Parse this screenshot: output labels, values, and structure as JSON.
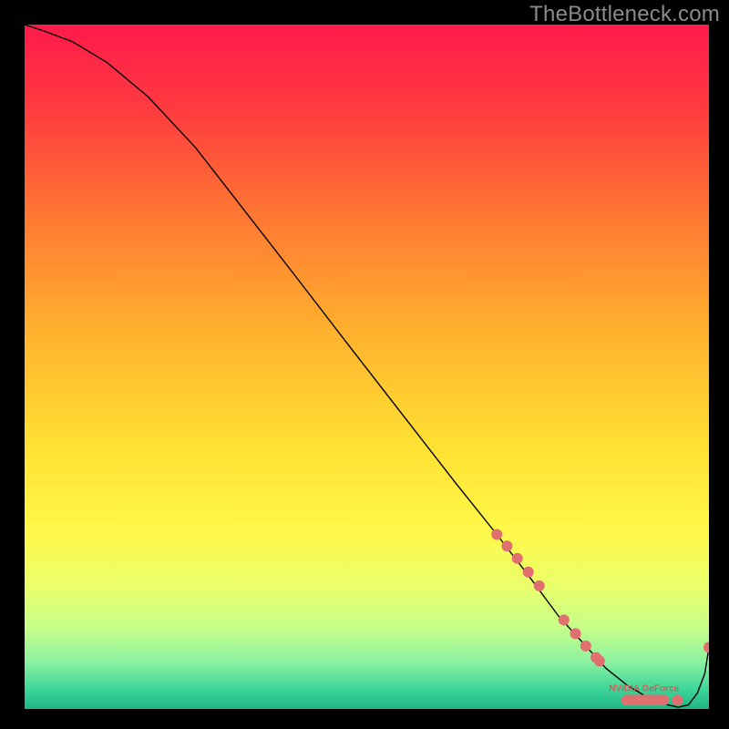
{
  "watermark": "TheBottleneck.com",
  "chart_data": {
    "type": "line",
    "title": "",
    "xlabel": "",
    "ylabel": "",
    "x_range": [
      0,
      100
    ],
    "y_range": [
      0,
      100
    ],
    "background": {
      "type": "vertical-gradient",
      "stops": [
        {
          "offset": 0.0,
          "color": "#ff1a4b"
        },
        {
          "offset": 0.12,
          "color": "#ff3a3f"
        },
        {
          "offset": 0.28,
          "color": "#ff7833"
        },
        {
          "offset": 0.45,
          "color": "#ffb22e"
        },
        {
          "offset": 0.62,
          "color": "#ffe233"
        },
        {
          "offset": 0.74,
          "color": "#fff84a"
        },
        {
          "offset": 0.82,
          "color": "#eaff6a"
        },
        {
          "offset": 0.88,
          "color": "#c7ff89"
        },
        {
          "offset": 0.93,
          "color": "#8ef2a0"
        },
        {
          "offset": 0.97,
          "color": "#3fd79a"
        },
        {
          "offset": 1.0,
          "color": "#1fb583"
        }
      ]
    },
    "series": [
      {
        "name": "curve",
        "color": "#000000",
        "width": 1.4,
        "x": [
          0,
          3,
          7,
          12,
          18,
          25,
          32,
          40,
          48,
          56,
          63,
          69,
          74,
          78,
          82,
          85,
          88,
          91,
          93.5,
          95.5,
          97,
          98.3,
          99.4,
          100
        ],
        "y": [
          100,
          99,
          97.5,
          94.5,
          89.5,
          82,
          73,
          62.7,
          52.3,
          42,
          33,
          25.5,
          19,
          13.6,
          9.2,
          5.9,
          3.5,
          1.7,
          0.7,
          0.25,
          0.6,
          2.3,
          5.2,
          9
        ]
      }
    ],
    "markers": {
      "color": "#e07070",
      "radius": 6,
      "points": [
        {
          "x": 69.0,
          "y": 25.5
        },
        {
          "x": 70.5,
          "y": 23.8
        },
        {
          "x": 72.0,
          "y": 22.0
        },
        {
          "x": 73.6,
          "y": 20.0
        },
        {
          "x": 75.2,
          "y": 18.0
        },
        {
          "x": 78.8,
          "y": 13.0
        },
        {
          "x": 80.5,
          "y": 11.0
        },
        {
          "x": 82.0,
          "y": 9.2
        },
        {
          "x": 83.5,
          "y": 7.5
        },
        {
          "x": 84.0,
          "y": 7.0
        },
        {
          "x": 88.0,
          "y": 1.3
        },
        {
          "x": 88.6,
          "y": 1.3
        },
        {
          "x": 89.2,
          "y": 1.3
        },
        {
          "x": 89.8,
          "y": 1.3
        },
        {
          "x": 90.4,
          "y": 1.3
        },
        {
          "x": 91.0,
          "y": 1.3
        },
        {
          "x": 91.6,
          "y": 1.3
        },
        {
          "x": 92.2,
          "y": 1.3
        },
        {
          "x": 92.8,
          "y": 1.3
        },
        {
          "x": 93.4,
          "y": 1.3
        },
        {
          "x": 95.4,
          "y": 1.3
        },
        {
          "x": 100.0,
          "y": 9.0
        }
      ]
    },
    "marker_label": {
      "text": "NVIDIA GeForce",
      "x": 90.5,
      "y": 2.6,
      "color": "#d85a5a",
      "font_px": 10
    }
  }
}
